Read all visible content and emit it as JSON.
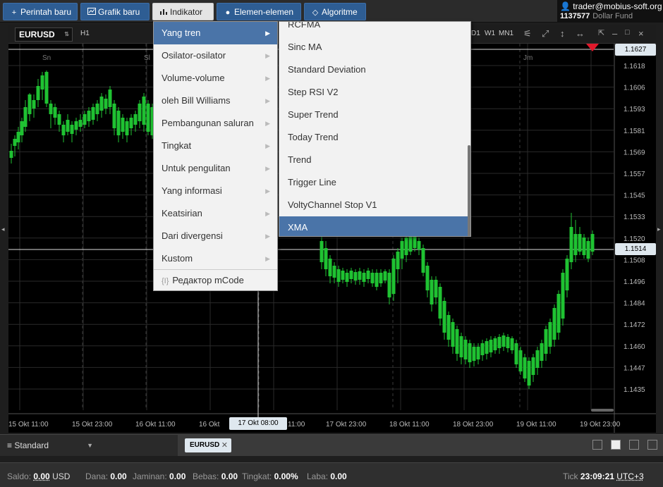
{
  "toolbar": {
    "new_order": "Perintah baru",
    "new_chart": "Grafik baru",
    "indicator": "Indikator",
    "elements": "Elemen-elemen",
    "algorithm": "Algoritme"
  },
  "account": {
    "email": "trader@mobius-soft.org",
    "id": "1137577",
    "fund": "Dollar Fund"
  },
  "chart": {
    "symbol": "EURUSD",
    "timeframe": "H1",
    "timeframes": [
      "D1",
      "W1",
      "MN1"
    ],
    "day_labels": [
      "Sn",
      "Sl",
      "Jm"
    ],
    "price_ticks": [
      "1.1618",
      "1.1606",
      "1.1593",
      "1.1581",
      "1.1569",
      "1.1557",
      "1.1545",
      "1.1533",
      "1.1520",
      "1.1508",
      "1.1496",
      "1.1484",
      "1.1472",
      "1.1460",
      "1.1447",
      "1.1435"
    ],
    "time_ticks": [
      "15 Okt 11:00",
      "15 Okt 23:00",
      "16 Okt 11:00",
      "16 Okt",
      "11:00",
      "17 Okt 23:00",
      "18 Okt 11:00",
      "18 Okt 23:00",
      "19 Okt 11:00",
      "19 Okt 23:00"
    ],
    "top_price_label": "1.1627",
    "current_price_label": "1.1514",
    "crosshair_time": "17 Okt 08:00",
    "colors": {
      "bull": "#1fc232",
      "bear": "#1fc232",
      "grid": "#2a2a2a",
      "marker": "#e0192b"
    }
  },
  "menu": {
    "main_items": [
      {
        "label": "Yang tren",
        "active": true
      },
      {
        "label": "Osilator-osilator",
        "active": false
      },
      {
        "label": "Volume-volume",
        "active": false
      },
      {
        "label": "oleh Bill Williams",
        "active": false
      },
      {
        "label": "Pembangunan saluran",
        "active": false
      },
      {
        "label": "Tingkat",
        "active": false
      },
      {
        "label": "Untuk pengulitan",
        "active": false
      },
      {
        "label": "Yang informasi",
        "active": false
      },
      {
        "label": "Keatsirian",
        "active": false
      },
      {
        "label": "Dari divergensi",
        "active": false
      },
      {
        "label": "Kustom",
        "active": false
      }
    ],
    "code_item": "Редактор mCode",
    "sub_items": [
      {
        "label": "RCFMA",
        "active": false
      },
      {
        "label": "Sinc MA",
        "active": false
      },
      {
        "label": "Standard Deviation",
        "active": false
      },
      {
        "label": "Step RSI V2",
        "active": false
      },
      {
        "label": "Super Trend",
        "active": false
      },
      {
        "label": "Today Trend",
        "active": false
      },
      {
        "label": "Trend",
        "active": false
      },
      {
        "label": "Trigger Line",
        "active": false
      },
      {
        "label": "VoltyChannel Stop V1",
        "active": false
      },
      {
        "label": "XMA",
        "active": true
      }
    ]
  },
  "bottom": {
    "workspace": "Standard",
    "chart_tab": "EURUSD"
  },
  "status": {
    "saldo_label": "Saldo:",
    "saldo_value": "0.00",
    "saldo_ccy": "USD",
    "dana_label": "Dana:",
    "dana_value": "0.00",
    "jaminan_label": "Jaminan:",
    "jaminan_value": "0.00",
    "bebas_label": "Bebas:",
    "bebas_value": "0.00",
    "tingkat_label": "Tingkat:",
    "tingkat_value": "0.00%",
    "laba_label": "Laba:",
    "laba_value": "0.00",
    "tick_label": "Tick",
    "time": "23:09:21",
    "tz": "UTC+3"
  }
}
